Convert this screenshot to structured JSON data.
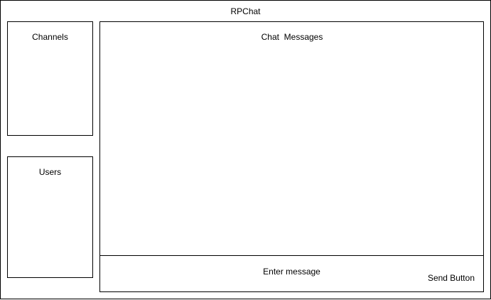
{
  "app": {
    "title": "RPChat"
  },
  "channels": {
    "label": "Channels"
  },
  "users": {
    "label": "Users"
  },
  "chat": {
    "messages_label": "Chat  Messages",
    "input_placeholder": "Enter message",
    "send_label": "Send Button"
  }
}
